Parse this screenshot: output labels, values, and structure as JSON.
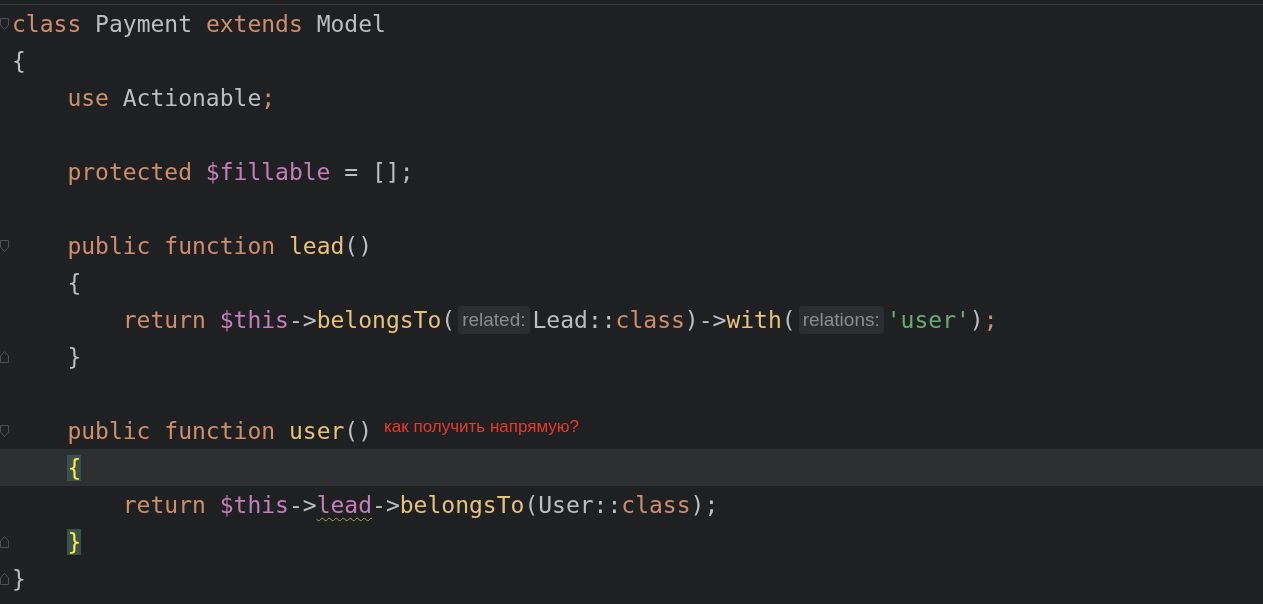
{
  "editor": {
    "lines": [
      {
        "kind": "code",
        "fold_start": true,
        "tokens": [
          {
            "t": "class",
            "kind": "keyword"
          },
          {
            "t": " Payment",
            "kind": "ident"
          },
          {
            "t": " extends",
            "kind": "keyword"
          },
          {
            "t": " Model",
            "kind": "ident"
          }
        ]
      },
      {
        "kind": "code",
        "tokens": [
          {
            "t": "{",
            "kind": "ident"
          }
        ],
        "children": [
          {
            "kind": "code",
            "tokens": [
              {
                "t": "use",
                "kind": "keyword"
              },
              {
                "t": " Actionable",
                "kind": "ident"
              },
              {
                "t": ";",
                "kind": "keyword"
              }
            ]
          },
          {
            "kind": "blank"
          },
          {
            "kind": "code",
            "tokens": [
              {
                "t": "protected",
                "kind": "keyword"
              },
              {
                "t": " $fillable",
                "kind": "variable"
              },
              {
                "t": " = [];",
                "kind": "ident"
              }
            ]
          },
          {
            "kind": "blank"
          },
          {
            "kind": "code",
            "fold_start": true,
            "tokens": [
              {
                "t": "public",
                "kind": "keyword"
              },
              {
                "t": " function",
                "kind": "keyword"
              },
              {
                "t": " lead",
                "kind": "function"
              },
              {
                "t": "()",
                "kind": "ident"
              }
            ]
          },
          {
            "kind": "code",
            "tokens": [
              {
                "t": "{",
                "kind": "ident"
              }
            ],
            "children": [
              {
                "kind": "code",
                "tokens": [
                  {
                    "t": "return",
                    "kind": "keyword"
                  },
                  {
                    "t": " $this",
                    "kind": "variable"
                  },
                  {
                    "t": "->",
                    "kind": "ident"
                  },
                  {
                    "t": "belongsTo",
                    "kind": "function"
                  },
                  {
                    "t": "(",
                    "kind": "ident"
                  },
                  {
                    "t": "related:",
                    "kind": "hint"
                  },
                  {
                    "t": "Lead::",
                    "kind": "ident"
                  },
                  {
                    "t": "class",
                    "kind": "keyword"
                  },
                  {
                    "t": ")->",
                    "kind": "ident"
                  },
                  {
                    "t": "with",
                    "kind": "function"
                  },
                  {
                    "t": "(",
                    "kind": "ident"
                  },
                  {
                    "t": "relations:",
                    "kind": "hint"
                  },
                  {
                    "t": "'user'",
                    "kind": "string"
                  },
                  {
                    "t": ")",
                    "kind": "ident"
                  },
                  {
                    "t": ";",
                    "kind": "keyword"
                  }
                ]
              }
            ]
          },
          {
            "kind": "code",
            "fold_end": true,
            "tokens": [
              {
                "t": "}",
                "kind": "ident"
              }
            ]
          },
          {
            "kind": "blank"
          },
          {
            "kind": "code",
            "fold_start": true,
            "tokens": [
              {
                "t": "public",
                "kind": "keyword"
              },
              {
                "t": " function",
                "kind": "keyword"
              },
              {
                "t": " user",
                "kind": "function"
              },
              {
                "t": "()",
                "kind": "ident"
              },
              {
                "t": "как получить напрямую?",
                "kind": "note"
              }
            ]
          },
          {
            "kind": "code",
            "current": true,
            "tokens": [
              {
                "t": "{",
                "kind": "ident",
                "matched": true
              }
            ],
            "children": [
              {
                "kind": "code",
                "tokens": [
                  {
                    "t": "return",
                    "kind": "keyword"
                  },
                  {
                    "t": " $this",
                    "kind": "variable"
                  },
                  {
                    "t": "->",
                    "kind": "ident"
                  },
                  {
                    "t": "lead",
                    "kind": "variable",
                    "warning": true
                  },
                  {
                    "t": "->",
                    "kind": "ident"
                  },
                  {
                    "t": "belongsTo",
                    "kind": "function"
                  },
                  {
                    "t": "(User::",
                    "kind": "ident"
                  },
                  {
                    "t": "class",
                    "kind": "keyword"
                  },
                  {
                    "t": ");",
                    "kind": "ident"
                  }
                ]
              }
            ]
          },
          {
            "kind": "code",
            "fold_end": true,
            "tokens": [
              {
                "t": "}",
                "kind": "ident",
                "matched": true
              }
            ]
          }
        ]
      },
      {
        "kind": "code",
        "fold_end": true,
        "tokens": [
          {
            "t": "}",
            "kind": "ident"
          }
        ]
      }
    ]
  }
}
